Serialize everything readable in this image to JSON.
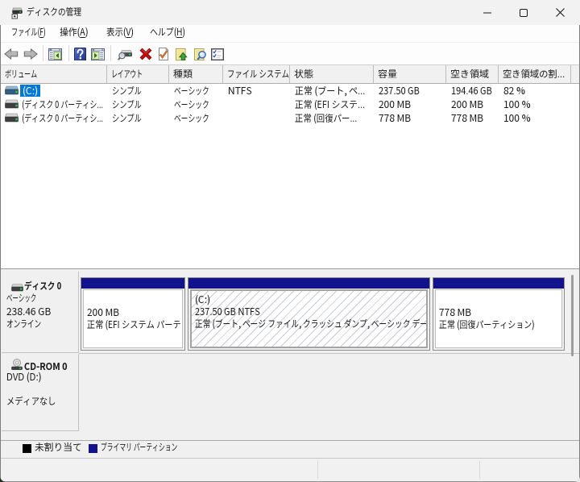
{
  "window": {
    "title": "ディスクの管理",
    "controls": {
      "minimize": "minimize-button",
      "maximize": "maximize-button",
      "close": "close-button"
    }
  },
  "menu": {
    "items": [
      {
        "label": "ファイル(F)"
      },
      {
        "label": "操作(A)"
      },
      {
        "label": "表示(V)"
      },
      {
        "label": "ヘルプ(H)"
      }
    ]
  },
  "toolbar": {
    "icons": [
      "back-icon",
      "forward-icon",
      "show-console-tree-icon",
      "help-icon",
      "show-action-pane-icon",
      "change-drive-letter-icon",
      "delete-volume-icon",
      "mark-partition-active-icon",
      "open-icon",
      "explore-icon",
      "properties-icon"
    ]
  },
  "volume_list": {
    "columns": [
      {
        "label": "ボリューム"
      },
      {
        "label": "レイアウト"
      },
      {
        "label": "種類"
      },
      {
        "label": "ファイル システム"
      },
      {
        "label": "状態"
      },
      {
        "label": "容量"
      },
      {
        "label": "空き領域"
      },
      {
        "label": "空き領域の割..."
      }
    ],
    "rows": [
      {
        "volume": "(C:)",
        "layout": "シンプル",
        "type": "ベーシック",
        "file_system": "NTFS",
        "status": "正常 (ブート, ペ...",
        "capacity": "237.50 GB",
        "free_space": "194.46 GB",
        "percent_free": "82 %",
        "selected": true
      },
      {
        "volume": "(ディスク 0 パーティシ...",
        "layout": "シンプル",
        "type": "ベーシック",
        "file_system": "",
        "status": "正常 (EFI システ...",
        "capacity": "200 MB",
        "free_space": "200 MB",
        "percent_free": "100 %",
        "selected": false
      },
      {
        "volume": "(ディスク 0 パーティシ...",
        "layout": "シンプル",
        "type": "ベーシック",
        "file_system": "",
        "status": "正常 (回復パー...",
        "capacity": "778 MB",
        "free_space": "778 MB",
        "percent_free": "100 %",
        "selected": false
      }
    ]
  },
  "disks": [
    {
      "name": "ディスク 0",
      "type": "ベーシック",
      "size": "238.46 GB",
      "status": "オンライン",
      "partitions": [
        {
          "line1": "200 MB",
          "line2": "正常 (EFI システム パーテ",
          "line3": "",
          "selected": false
        },
        {
          "line1": "(C:)",
          "line2": "237.50 GB NTFS",
          "line3": "正常 (ブート, ページ ファイル, クラッシュ ダンプ, ベーシック データ",
          "selected": true
        },
        {
          "line1": "778 MB",
          "line2": "正常 (回復パーティション)",
          "line3": "",
          "selected": false
        }
      ]
    },
    {
      "name": "CD-ROM 0",
      "type": "DVD (D:)",
      "status": "メディアなし"
    }
  ],
  "legend": {
    "items": [
      {
        "label": "未割り当て",
        "color": "#000000"
      },
      {
        "label": "プライマリ パーティション",
        "color": "#12128c"
      }
    ]
  },
  "colors": {
    "selection_blue": "#0078d7",
    "primary_partition_navy": "#12128c",
    "titlebar_bg": "#f2f1f1",
    "pane_bg": "#f0f0f0"
  }
}
